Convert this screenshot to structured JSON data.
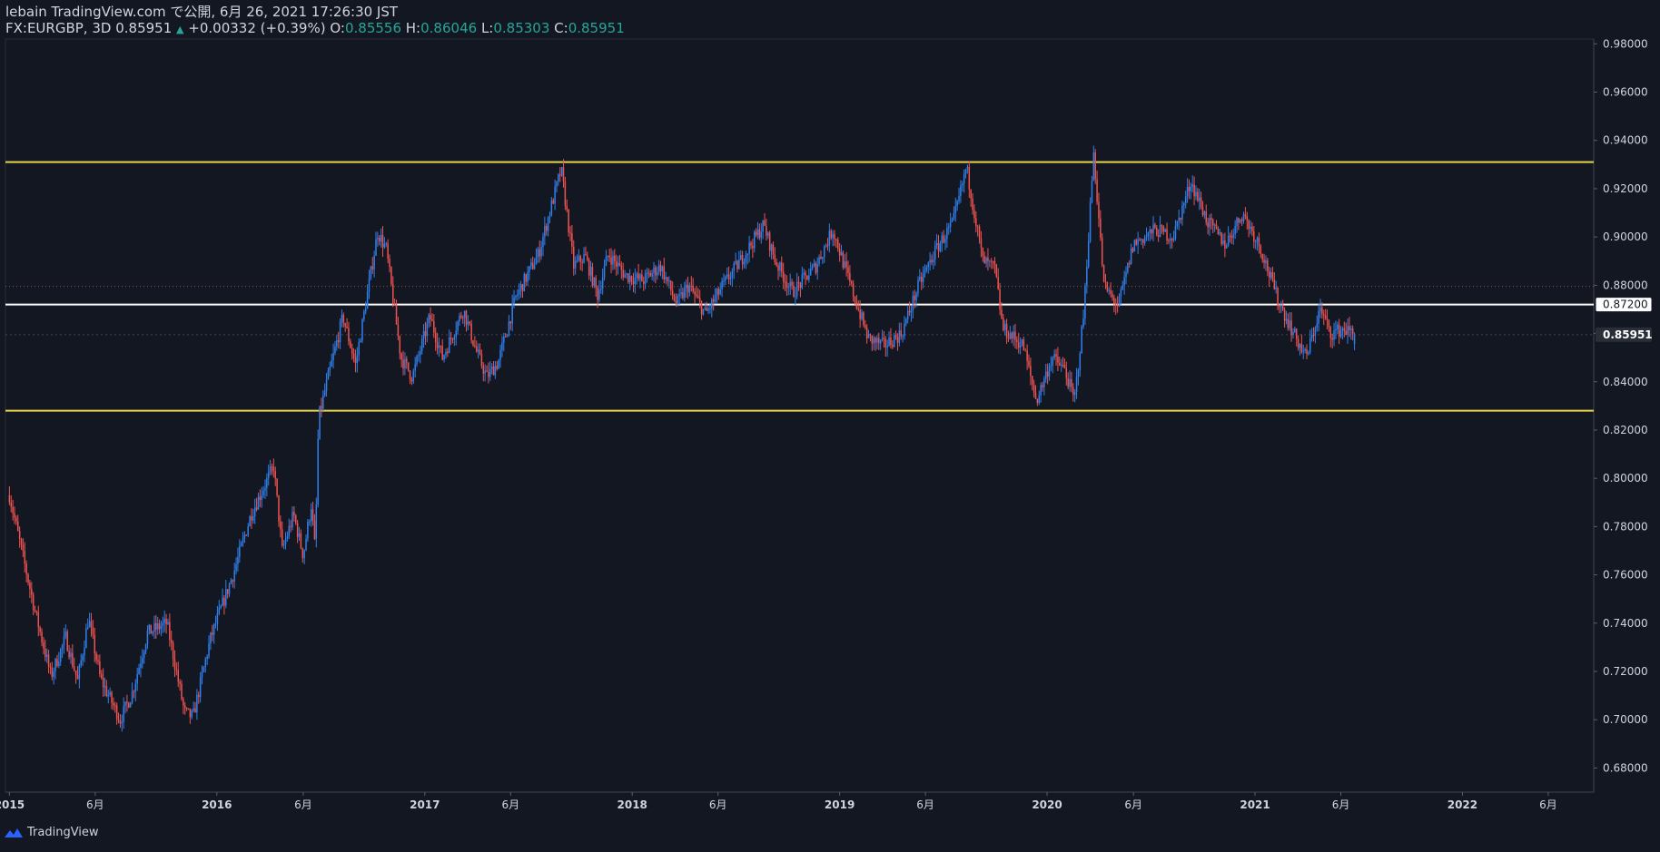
{
  "header": {
    "publish_line": "lebain TradingView.com で公開, 6月 26, 2021 17:26:30 JST",
    "symbol": "FX:EURGBP, 3D",
    "last": "0.85951",
    "change_arrow": "▲",
    "change": "+0.00332 (+0.39%)",
    "o_label": "O:",
    "o_value": "0.85556",
    "h_label": "H:",
    "h_value": "0.86046",
    "l_label": "L:",
    "l_value": "0.85303",
    "c_label": "C:",
    "c_value": "0.85951"
  },
  "footer": {
    "brand": "TradingView",
    "logo_icon": "tradingview-logo-icon"
  },
  "colors": {
    "background": "#131722",
    "up": "#2f80ed",
    "down": "#ef5350",
    "support_resistance": "#e8d44d",
    "mid_line": "#ffffff",
    "text": "#d1d4dc",
    "positive": "#26a69a"
  },
  "chart_data": {
    "type": "candlestick",
    "symbol": "FX:EURGBP",
    "timeframe": "3D",
    "ylim": [
      0.67,
      0.982
    ],
    "y_ticks": [
      "0.98000",
      "0.96000",
      "0.94000",
      "0.92000",
      "0.90000",
      "0.88000",
      "0.86000",
      "0.84000",
      "0.82000",
      "0.80000",
      "0.78000",
      "0.76000",
      "0.74000",
      "0.72000",
      "0.70000",
      "0.68000"
    ],
    "y_tick_values": [
      0.98,
      0.96,
      0.94,
      0.92,
      0.9,
      0.88,
      0.86,
      0.84,
      0.82,
      0.8,
      0.78,
      0.76,
      0.74,
      0.72,
      0.7,
      0.68
    ],
    "x_range": [
      "2014-12-25",
      "2022-08-20"
    ],
    "x_ticks": [
      {
        "label": "2015",
        "date": "2015-01-01"
      },
      {
        "label": "6月",
        "date": "2015-06-01"
      },
      {
        "label": "2016",
        "date": "2016-01-01"
      },
      {
        "label": "6月",
        "date": "2016-06-01"
      },
      {
        "label": "2017",
        "date": "2017-01-01"
      },
      {
        "label": "6月",
        "date": "2017-06-01"
      },
      {
        "label": "2018",
        "date": "2018-01-01"
      },
      {
        "label": "6月",
        "date": "2018-06-01"
      },
      {
        "label": "2019",
        "date": "2019-01-01"
      },
      {
        "label": "6月",
        "date": "2019-06-01"
      },
      {
        "label": "2020",
        "date": "2020-01-01"
      },
      {
        "label": "6月",
        "date": "2020-06-01"
      },
      {
        "label": "2021",
        "date": "2021-01-01"
      },
      {
        "label": "6月",
        "date": "2021-06-01"
      },
      {
        "label": "2022",
        "date": "2022-01-01"
      },
      {
        "label": "6月",
        "date": "2022-06-01"
      }
    ],
    "horizontal_lines": [
      {
        "value": 0.931,
        "color": "#e8d44d",
        "role": "resistance"
      },
      {
        "value": 0.872,
        "color": "#ffffff",
        "label": "0.87200"
      },
      {
        "value": 0.828,
        "color": "#e8d44d",
        "role": "support"
      }
    ],
    "dotted_line": 0.8795,
    "last_price": {
      "value": 0.85951,
      "label": "0.85951"
    },
    "last_candle": {
      "open": 0.85556,
      "high": 0.86046,
      "low": 0.85303,
      "close": 0.85951
    },
    "price_path": [
      {
        "date": "2015-01-01",
        "close": 0.793
      },
      {
        "date": "2015-02-15",
        "close": 0.745
      },
      {
        "date": "2015-03-15",
        "close": 0.718
      },
      {
        "date": "2015-04-10",
        "close": 0.734
      },
      {
        "date": "2015-05-01",
        "close": 0.716
      },
      {
        "date": "2015-05-20",
        "close": 0.742
      },
      {
        "date": "2015-06-10",
        "close": 0.717
      },
      {
        "date": "2015-07-15",
        "close": 0.7
      },
      {
        "date": "2015-08-05",
        "close": 0.711
      },
      {
        "date": "2015-09-01",
        "close": 0.736
      },
      {
        "date": "2015-10-05",
        "close": 0.74
      },
      {
        "date": "2015-11-05",
        "close": 0.703
      },
      {
        "date": "2015-11-20",
        "close": 0.701
      },
      {
        "date": "2015-12-20",
        "close": 0.733
      },
      {
        "date": "2016-02-01",
        "close": 0.762
      },
      {
        "date": "2016-03-01",
        "close": 0.785
      },
      {
        "date": "2016-04-10",
        "close": 0.805
      },
      {
        "date": "2016-04-25",
        "close": 0.77
      },
      {
        "date": "2016-05-15",
        "close": 0.785
      },
      {
        "date": "2016-06-01",
        "close": 0.768
      },
      {
        "date": "2016-06-15",
        "close": 0.789
      },
      {
        "date": "2016-06-22",
        "close": 0.77
      },
      {
        "date": "2016-06-28",
        "close": 0.825
      },
      {
        "date": "2016-07-15",
        "close": 0.842
      },
      {
        "date": "2016-08-10",
        "close": 0.867
      },
      {
        "date": "2016-09-01",
        "close": 0.847
      },
      {
        "date": "2016-10-10",
        "close": 0.902
      },
      {
        "date": "2016-10-25",
        "close": 0.895
      },
      {
        "date": "2016-11-20",
        "close": 0.85
      },
      {
        "date": "2016-12-10",
        "close": 0.842
      },
      {
        "date": "2017-01-10",
        "close": 0.867
      },
      {
        "date": "2017-02-01",
        "close": 0.85
      },
      {
        "date": "2017-03-10",
        "close": 0.87
      },
      {
        "date": "2017-04-01",
        "close": 0.853
      },
      {
        "date": "2017-04-20",
        "close": 0.842
      },
      {
        "date": "2017-05-10",
        "close": 0.848
      },
      {
        "date": "2017-06-10",
        "close": 0.875
      },
      {
        "date": "2017-07-20",
        "close": 0.893
      },
      {
        "date": "2017-08-29",
        "close": 0.928
      },
      {
        "date": "2017-09-20",
        "close": 0.888
      },
      {
        "date": "2017-10-10",
        "close": 0.892
      },
      {
        "date": "2017-11-01",
        "close": 0.876
      },
      {
        "date": "2017-11-20",
        "close": 0.893
      },
      {
        "date": "2017-12-20",
        "close": 0.884
      },
      {
        "date": "2018-01-20",
        "close": 0.882
      },
      {
        "date": "2018-02-20",
        "close": 0.888
      },
      {
        "date": "2018-03-20",
        "close": 0.872
      },
      {
        "date": "2018-04-10",
        "close": 0.88
      },
      {
        "date": "2018-05-10",
        "close": 0.868
      },
      {
        "date": "2018-06-10",
        "close": 0.88
      },
      {
        "date": "2018-07-10",
        "close": 0.89
      },
      {
        "date": "2018-08-20",
        "close": 0.905
      },
      {
        "date": "2018-09-10",
        "close": 0.89
      },
      {
        "date": "2018-10-10",
        "close": 0.877
      },
      {
        "date": "2018-11-20",
        "close": 0.888
      },
      {
        "date": "2018-12-20",
        "close": 0.903
      },
      {
        "date": "2019-01-20",
        "close": 0.88
      },
      {
        "date": "2019-02-20",
        "close": 0.858
      },
      {
        "date": "2019-03-20",
        "close": 0.855
      },
      {
        "date": "2019-04-20",
        "close": 0.86
      },
      {
        "date": "2019-05-20",
        "close": 0.88
      },
      {
        "date": "2019-06-20",
        "close": 0.895
      },
      {
        "date": "2019-07-20",
        "close": 0.906
      },
      {
        "date": "2019-08-12",
        "close": 0.929
      },
      {
        "date": "2019-09-10",
        "close": 0.89
      },
      {
        "date": "2019-10-01",
        "close": 0.887
      },
      {
        "date": "2019-10-15",
        "close": 0.862
      },
      {
        "date": "2019-11-20",
        "close": 0.855
      },
      {
        "date": "2019-12-13",
        "close": 0.832
      },
      {
        "date": "2020-01-10",
        "close": 0.85
      },
      {
        "date": "2020-02-01",
        "close": 0.845
      },
      {
        "date": "2020-02-18",
        "close": 0.832
      },
      {
        "date": "2020-03-05",
        "close": 0.867
      },
      {
        "date": "2020-03-23",
        "close": 0.935
      },
      {
        "date": "2020-04-10",
        "close": 0.88
      },
      {
        "date": "2020-05-05",
        "close": 0.871
      },
      {
        "date": "2020-06-01",
        "close": 0.897
      },
      {
        "date": "2020-07-10",
        "close": 0.903
      },
      {
        "date": "2020-08-10",
        "close": 0.9
      },
      {
        "date": "2020-09-10",
        "close": 0.923
      },
      {
        "date": "2020-10-10",
        "close": 0.906
      },
      {
        "date": "2020-11-10",
        "close": 0.897
      },
      {
        "date": "2020-12-10",
        "close": 0.91
      },
      {
        "date": "2021-01-10",
        "close": 0.896
      },
      {
        "date": "2021-02-10",
        "close": 0.874
      },
      {
        "date": "2021-03-10",
        "close": 0.86
      },
      {
        "date": "2021-04-01",
        "close": 0.85
      },
      {
        "date": "2021-04-25",
        "close": 0.87
      },
      {
        "date": "2021-05-15",
        "close": 0.86
      },
      {
        "date": "2021-06-05",
        "close": 0.862
      },
      {
        "date": "2021-06-25",
        "close": 0.8595
      }
    ]
  }
}
